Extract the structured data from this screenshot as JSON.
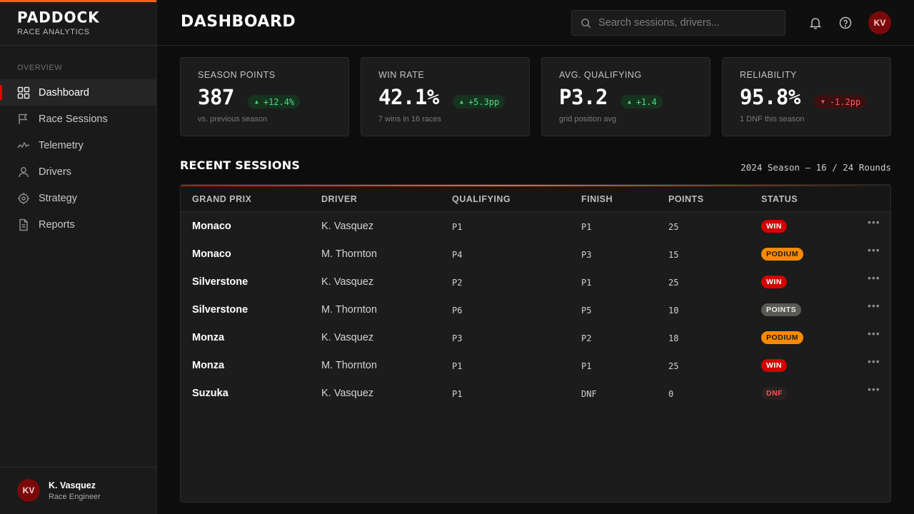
{
  "brand": {
    "name": "PADDOCK",
    "subtitle": "RACE ANALYTICS"
  },
  "sidebar": {
    "section_label": "OVERVIEW",
    "items": [
      {
        "label": "Dashboard",
        "icon": "grid-icon",
        "active": true
      },
      {
        "label": "Race Sessions",
        "icon": "flag-icon"
      },
      {
        "label": "Telemetry",
        "icon": "pulse-icon"
      },
      {
        "label": "Drivers",
        "icon": "user-icon"
      },
      {
        "label": "Strategy",
        "icon": "target-icon"
      },
      {
        "label": "Reports",
        "icon": "document-icon"
      }
    ],
    "user": {
      "initials": "KV",
      "name": "K. Vasquez",
      "role": "Race Engineer"
    }
  },
  "header": {
    "title": "DASHBOARD",
    "search_placeholder": "Search sessions, drivers...",
    "avatar_initials": "KV"
  },
  "kpis": [
    {
      "label": "SEASON POINTS",
      "value": "387",
      "delta": "+12.4%",
      "direction": "up",
      "note": "vs. previous season"
    },
    {
      "label": "WIN RATE",
      "value": "42.1%",
      "delta": "+5.3pp",
      "direction": "up",
      "note": "7 wins in 16 races"
    },
    {
      "label": "AVG. QUALIFYING",
      "value": "P3.2",
      "delta": "+1.4",
      "direction": "up",
      "note": "grid position avg"
    },
    {
      "label": "RELIABILITY",
      "value": "95.8%",
      "delta": "-1.2pp",
      "direction": "down",
      "note": "1 DNF this season"
    }
  ],
  "sessions": {
    "title": "RECENT SESSIONS",
    "season_info": "2024 Season — 16 / 24 Rounds",
    "columns": [
      "GRAND PRIX",
      "DRIVER",
      "QUALIFYING",
      "FINISH",
      "POINTS",
      "STATUS"
    ],
    "rows": [
      {
        "gp": "Monaco",
        "driver": "K. Vasquez",
        "qualifying": "P1",
        "finish": "P1",
        "points": "25",
        "status": "WIN"
      },
      {
        "gp": "Monaco",
        "driver": "M. Thornton",
        "qualifying": "P4",
        "finish": "P3",
        "points": "15",
        "status": "PODIUM"
      },
      {
        "gp": "Silverstone",
        "driver": "K. Vasquez",
        "qualifying": "P2",
        "finish": "P1",
        "points": "25",
        "status": "WIN"
      },
      {
        "gp": "Silverstone",
        "driver": "M. Thornton",
        "qualifying": "P6",
        "finish": "P5",
        "points": "10",
        "status": "POINTS"
      },
      {
        "gp": "Monza",
        "driver": "K. Vasquez",
        "qualifying": "P3",
        "finish": "P2",
        "points": "18",
        "status": "PODIUM"
      },
      {
        "gp": "Monza",
        "driver": "M. Thornton",
        "qualifying": "P1",
        "finish": "P1",
        "points": "25",
        "status": "WIN"
      },
      {
        "gp": "Suzuka",
        "driver": "K. Vasquez",
        "qualifying": "P1",
        "finish": "DNF",
        "points": "0",
        "status": "DNF"
      }
    ],
    "row_menu_glyph": "•••"
  },
  "colors": {
    "accent_red": "#e10600",
    "accent_orange": "#ff5a1f",
    "win": "#d40000",
    "podium": "#ff8a00",
    "points": "#5a5a55",
    "dnf_text": "#ff5050",
    "positive": "#4ade80",
    "negative": "#ff5a5a"
  }
}
